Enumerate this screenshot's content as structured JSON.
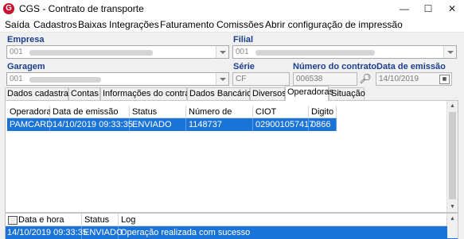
{
  "window": {
    "title": "CGS - Contrato de transporte",
    "minimize": "—",
    "maximize": "☐",
    "close": "✕"
  },
  "menu": [
    "Saída",
    "Cadastros",
    "Baixas",
    "Integrações",
    "Faturamento",
    "Comissões",
    "Abrir configuração de impressão"
  ],
  "form": {
    "empresa": {
      "label": "Empresa",
      "value": "001"
    },
    "filial": {
      "label": "Filial",
      "value": "001"
    },
    "garagem": {
      "label": "Garagem",
      "value": "001"
    },
    "serie": {
      "label": "Série",
      "value": "CF"
    },
    "numero_contrato": {
      "label": "Número do contrato",
      "value": "006538"
    },
    "data_emissao": {
      "label": "Data de emissão",
      "value": "14/10/2019"
    }
  },
  "tabs": [
    "Dados cadastrais",
    "Contas",
    "Informações do contrato",
    "Dados Bancários",
    "Diversos",
    "Operadoras",
    "Situação"
  ],
  "active_tab": "Operadoras",
  "grid": {
    "columns": [
      "Operadora",
      "Data de emissão",
      "Status",
      "Número de retorno",
      "CIOT",
      "Digito"
    ],
    "rows": [
      [
        "PAMCARD",
        "14/10/2019 09:33:35",
        "ENVIADO",
        "1148737",
        "029001057417",
        "0866"
      ]
    ]
  },
  "log": {
    "columns": [
      "Data e hora",
      "Status",
      "Log"
    ],
    "rows": [
      [
        "14/10/2019 09:33:35",
        "ENVIADO",
        "Operação realizada com sucesso"
      ]
    ]
  }
}
